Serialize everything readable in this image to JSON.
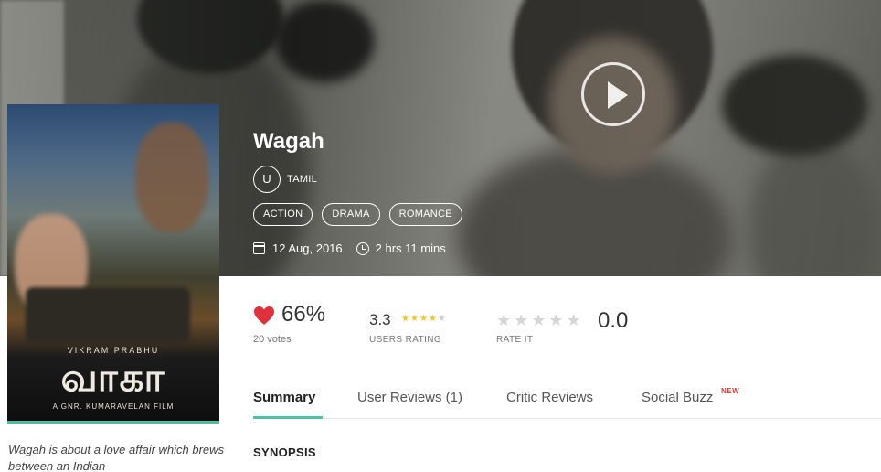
{
  "movie": {
    "title": "Wagah",
    "certificate": "U",
    "language": "TAMIL",
    "genres": [
      "ACTION",
      "DRAMA",
      "ROMANCE"
    ],
    "release_date": "12 Aug, 2016",
    "duration": "2 hrs 11 mins"
  },
  "poster": {
    "actor": "VIKRAM PRABHU",
    "title": "வாகா",
    "director": "A GNR. KUMARAVELAN FILM",
    "caption": "Wagah is about a love affair which brews between an Indian"
  },
  "ratings": {
    "like_percent": "66%",
    "votes": "20 votes",
    "users_score": "3.3",
    "users_stars": 3.3,
    "users_label": "USERS RATING",
    "rate_label": "RATE IT",
    "rate_value": "0.0",
    "accent_color": "#e0303b"
  },
  "tabs": [
    {
      "label": "Summary",
      "active": true
    },
    {
      "label": "User Reviews (1)",
      "active": false
    },
    {
      "label": "Critic Reviews",
      "active": false
    },
    {
      "label": "Social Buzz",
      "active": false,
      "badge": "NEW"
    }
  ],
  "section": {
    "synopsis_heading": "SYNOPSIS"
  },
  "theme": {
    "tab_accent": "#4cc1a1"
  }
}
